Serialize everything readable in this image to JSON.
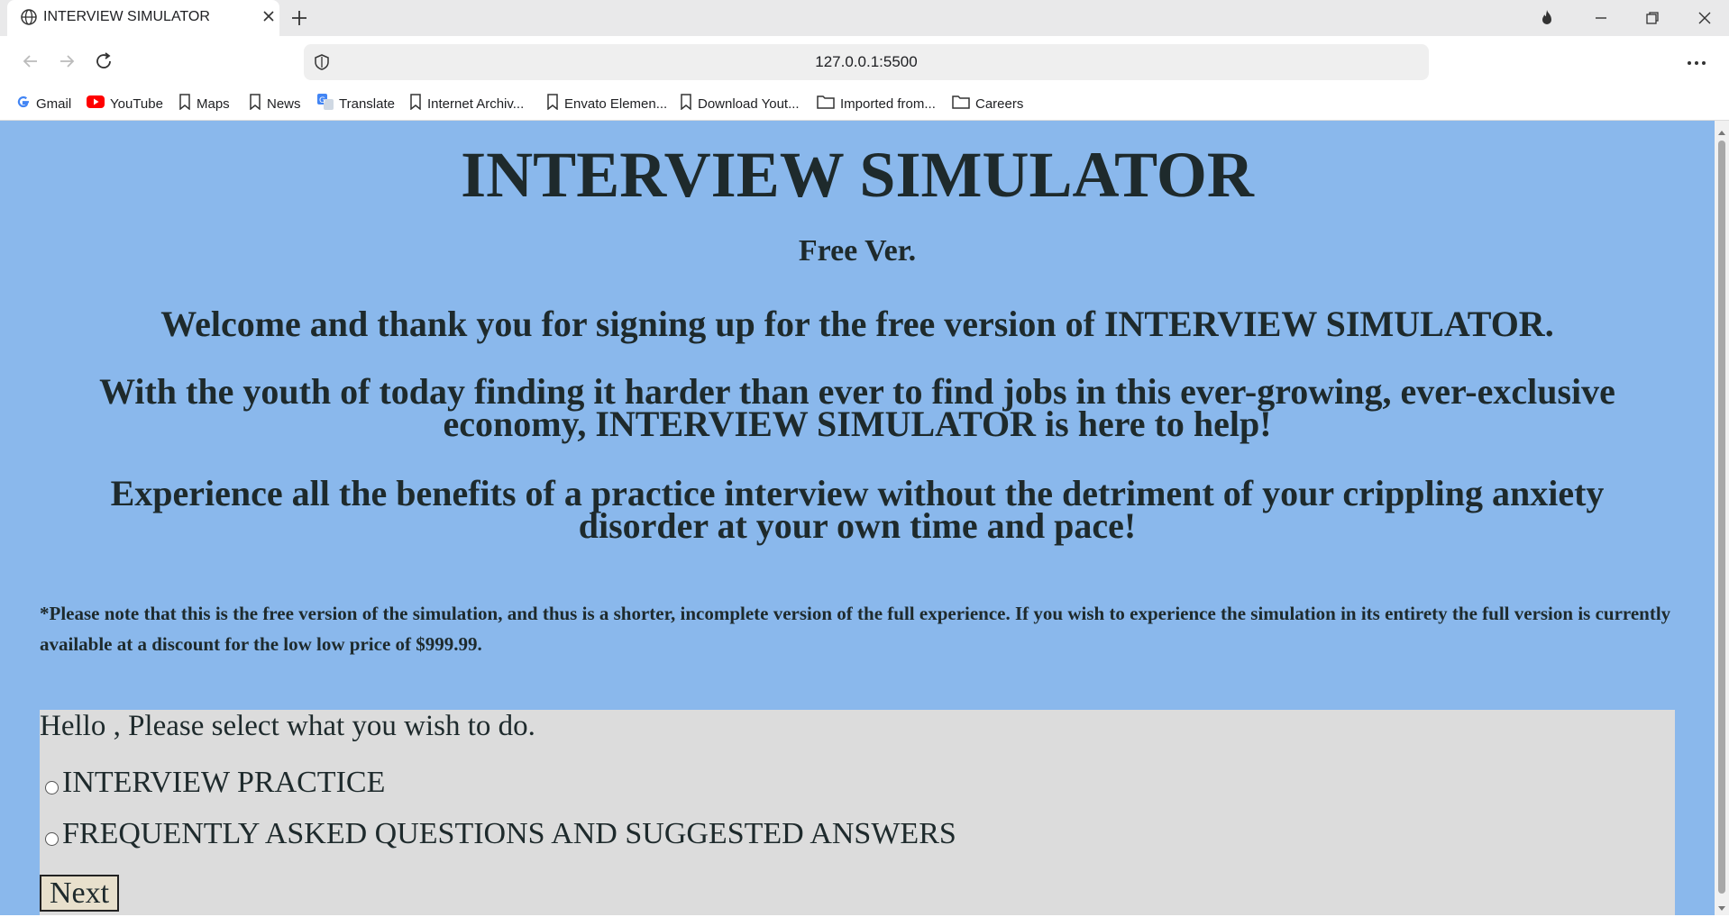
{
  "browser": {
    "tab_title": "INTERVIEW SIMULATOR",
    "url": "127.0.0.1:5500",
    "bookmarks": [
      {
        "label": "Gmail",
        "icon": "google-icon"
      },
      {
        "label": "YouTube",
        "icon": "youtube-icon"
      },
      {
        "label": "Maps",
        "icon": "bookmark-icon"
      },
      {
        "label": "News",
        "icon": "bookmark-icon"
      },
      {
        "label": "Translate",
        "icon": "translate-icon"
      },
      {
        "label": "Internet Archiv...",
        "icon": "bookmark-icon"
      },
      {
        "label": "Envato Elemen...",
        "icon": "bookmark-icon"
      },
      {
        "label": "Download Yout...",
        "icon": "bookmark-icon"
      },
      {
        "label": "Imported from...",
        "icon": "folder-icon"
      },
      {
        "label": "Careers",
        "icon": "folder-icon"
      }
    ]
  },
  "page": {
    "title": "INTERVIEW SIMULATOR",
    "subtitle": "Free Ver.",
    "welcome": "Welcome and thank you for signing up for the free version of INTERVIEW SIMULATOR.",
    "youth": "With the youth of today finding it harder than ever to find jobs in this ever-growing, ever-exclusive economy, INTERVIEW SIMULATOR is here to help!",
    "experience": "Experience all the benefits of a practice interview without the detriment of your crippling anxiety disorder at your own time and pace!",
    "note": "*Please note that this is the free version of the simulation, and thus is a shorter, incomplete version of the full experience. If you wish to experience the simulation in its entirety the full version is currently available at a discount for the low low price of $999.99.",
    "panel": {
      "greeting": "Hello , Please select what you wish to do.",
      "options": [
        {
          "label": "INTERVIEW PRACTICE",
          "selected": false
        },
        {
          "label": "FREQUENTLY ASKED QUESTIONS AND SUGGESTED ANSWERS",
          "selected": false
        }
      ],
      "next_label": "Next"
    }
  },
  "colors": {
    "page_background": "#8ab8ec",
    "panel_background": "#dcdcdc",
    "text": "#1e2a2c",
    "button_background": "#e8e0cc"
  }
}
